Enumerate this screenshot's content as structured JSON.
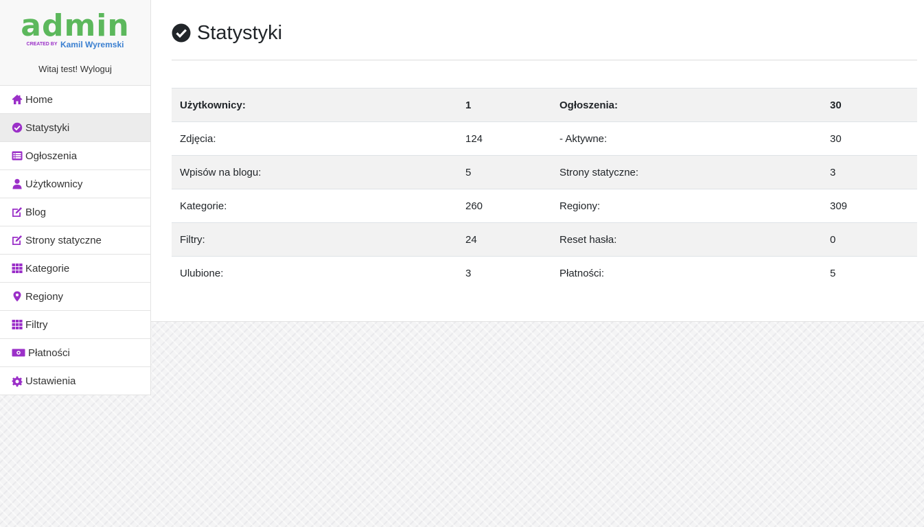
{
  "brand": {
    "logo_text": "admin",
    "logo_created": "CREATED BY",
    "logo_author": "Kamil Wyremski",
    "welcome": "Witaj test!",
    "logout": "Wyloguj"
  },
  "accent_color": "#9b30c8",
  "logo_color": "#5cb85c",
  "menu": [
    {
      "label": "Home",
      "icon": "home-icon"
    },
    {
      "label": "Statystyki",
      "icon": "check-circle-icon",
      "active": true
    },
    {
      "label": "Ogłoszenia",
      "icon": "list-icon"
    },
    {
      "label": "Użytkownicy",
      "icon": "user-icon"
    },
    {
      "label": "Blog",
      "icon": "edit-icon"
    },
    {
      "label": "Strony statyczne",
      "icon": "edit-icon"
    },
    {
      "label": "Kategorie",
      "icon": "grid-icon"
    },
    {
      "label": "Regiony",
      "icon": "map-marker-icon"
    },
    {
      "label": "Filtry",
      "icon": "grid-icon"
    },
    {
      "label": "Płatności",
      "icon": "money-icon"
    },
    {
      "label": "Ustawienia",
      "icon": "gear-icon"
    }
  ],
  "page": {
    "title": "Statystyki",
    "title_icon": "check-circle-icon"
  },
  "stats": [
    [
      "Użytkownicy:",
      "1",
      "Ogłoszenia:",
      "30"
    ],
    [
      "Zdjęcia:",
      "124",
      "- Aktywne:",
      "30"
    ],
    [
      "Wpisów na blogu:",
      "5",
      "Strony statyczne:",
      "3"
    ],
    [
      "Kategorie:",
      "260",
      "Regiony:",
      "309"
    ],
    [
      "Filtry:",
      "24",
      "Reset hasła:",
      "0"
    ],
    [
      "Ulubione:",
      "3",
      "Płatności:",
      "5"
    ]
  ]
}
